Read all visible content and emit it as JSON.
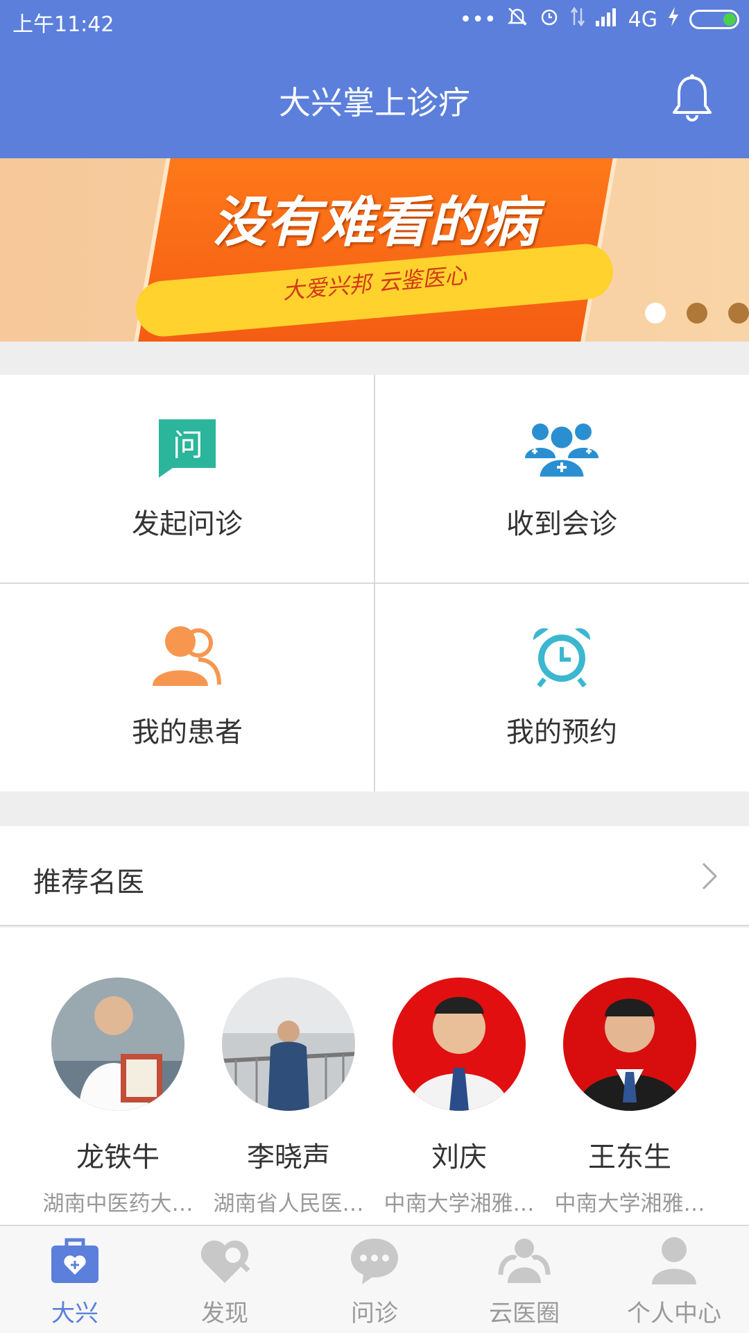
{
  "status_bar": {
    "time": "上午11:42",
    "network": "4G"
  },
  "header": {
    "title": "大兴掌上诊疗"
  },
  "banner": {
    "headline": "没有难看的病",
    "subtitle": "大爱兴邦 云鉴医心",
    "slide_count": 3,
    "active_slide": 0
  },
  "actions": [
    {
      "label": "发起问诊",
      "icon": "question-chat-icon",
      "icon_text": "问",
      "color": "#2bb59a"
    },
    {
      "label": "收到会诊",
      "icon": "consultation-group-icon",
      "color": "#2a8fd1"
    },
    {
      "label": "我的患者",
      "icon": "patients-icon",
      "color": "#f7964f"
    },
    {
      "label": "我的预约",
      "icon": "alarm-clock-icon",
      "color": "#3bb7cf"
    }
  ],
  "recommended": {
    "title": "推荐名医",
    "doctors": [
      {
        "name": "龙铁牛",
        "hospital": "湖南中医药大…"
      },
      {
        "name": "李晓声",
        "hospital": "湖南省人民医…"
      },
      {
        "name": "刘庆",
        "hospital": "中南大学湘雅…"
      },
      {
        "name": "王东生",
        "hospital": "中南大学湘雅…"
      }
    ]
  },
  "tabs": [
    {
      "label": "大兴",
      "icon": "medical-kit-icon",
      "active": true
    },
    {
      "label": "发现",
      "icon": "discover-icon",
      "active": false
    },
    {
      "label": "问诊",
      "icon": "chat-bubble-icon",
      "active": false
    },
    {
      "label": "云医圈",
      "icon": "community-icon",
      "active": false
    },
    {
      "label": "个人中心",
      "icon": "profile-icon",
      "active": false
    }
  ],
  "colors": {
    "primary": "#5b7fdb",
    "inactive": "#9a9a9a"
  }
}
